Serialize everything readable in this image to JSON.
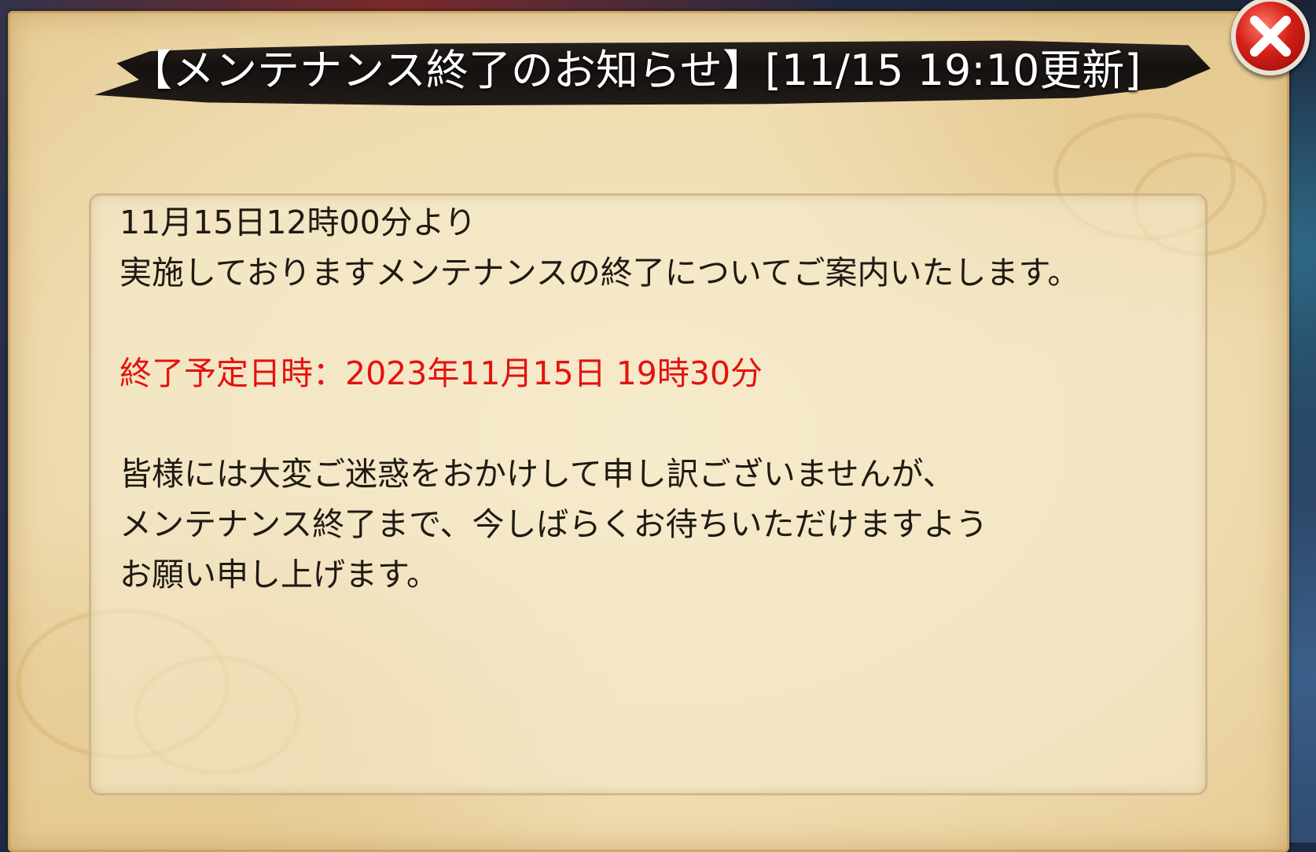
{
  "dialog": {
    "title": "【メンテナンス終了のお知らせ】[11/15 19:10更新]",
    "close_icon": "close-x-icon",
    "body": {
      "line1": "11月15日12時00分より",
      "line2": "実施しておりますメンテナンスの終了についてご案内いたします。",
      "highlight": "終了予定日時：2023年11月15日 19時30分",
      "line4": "皆様には大変ご迷惑をおかけして申し訳ございませんが、",
      "line5": "メンテナンス終了まで、今しばらくお待ちいただけますよう",
      "line6": "お願い申し上げます。"
    }
  },
  "colors": {
    "highlight": "#e4120f",
    "close_button": "#d41f17",
    "parchment": "#f1e2bb"
  }
}
